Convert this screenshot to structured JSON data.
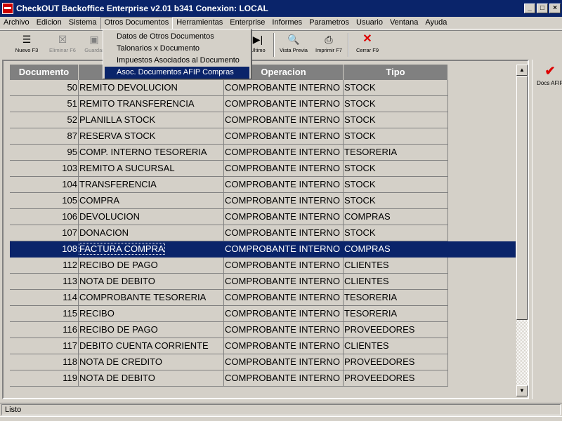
{
  "window": {
    "title": "CheckOUT Backoffice Enterprise v2.01 b341 Conexion: LOCAL",
    "min_label": "_",
    "max_label": "□",
    "close_label": "×"
  },
  "menu": {
    "items": [
      "Archivo",
      "Edicion",
      "Sistema",
      "Otros Documentos",
      "Herramientas",
      "Enterprise",
      "Informes",
      "Parametros",
      "Usuario",
      "Ventana",
      "Ayuda"
    ],
    "open_index": 3
  },
  "dropdown": {
    "items": [
      "Datos de Otros Documentos",
      "Talonarios x Documento",
      "Impuestos Asociados al Documento",
      "Asoc. Documentos AFIP Compras"
    ],
    "highlighted_index": 3
  },
  "toolbar": {
    "nuevo": "Nuevo F3",
    "eliminar": "Eliminar F6",
    "guardar": "Guardar",
    "ultimo": "Ultimo",
    "vista_previa": "Vista Previa",
    "imprimir": "Imprimir F7",
    "cerrar": "Cerrar F9"
  },
  "grid": {
    "columns": [
      "Documento",
      "",
      "Operacion",
      "Tipo"
    ],
    "selected_index": 10,
    "rows": [
      {
        "id": "50",
        "desc": "REMITO DEVOLUCION",
        "op": "COMPROBANTE INTERNO",
        "tipo": "STOCK"
      },
      {
        "id": "51",
        "desc": "REMITO TRANSFERENCIA",
        "op": "COMPROBANTE INTERNO",
        "tipo": "STOCK"
      },
      {
        "id": "52",
        "desc": "PLANILLA STOCK",
        "op": "COMPROBANTE INTERNO",
        "tipo": "STOCK"
      },
      {
        "id": "87",
        "desc": "RESERVA STOCK",
        "op": "COMPROBANTE INTERNO",
        "tipo": "STOCK"
      },
      {
        "id": "95",
        "desc": "COMP. INTERNO TESORERIA",
        "op": "COMPROBANTE INTERNO",
        "tipo": "TESORERIA"
      },
      {
        "id": "103",
        "desc": "REMITO A SUCURSAL",
        "op": "COMPROBANTE INTERNO",
        "tipo": "STOCK"
      },
      {
        "id": "104",
        "desc": "TRANSFERENCIA",
        "op": "COMPROBANTE INTERNO",
        "tipo": "STOCK"
      },
      {
        "id": "105",
        "desc": "COMPRA",
        "op": "COMPROBANTE INTERNO",
        "tipo": "STOCK"
      },
      {
        "id": "106",
        "desc": "DEVOLUCION",
        "op": "COMPROBANTE INTERNO",
        "tipo": "COMPRAS"
      },
      {
        "id": "107",
        "desc": "DONACION",
        "op": "COMPROBANTE INTERNO",
        "tipo": "STOCK"
      },
      {
        "id": "108",
        "desc": "FACTURA COMPRA",
        "op": "COMPROBANTE INTERNO",
        "tipo": "COMPRAS"
      },
      {
        "id": "112",
        "desc": "RECIBO DE PAGO",
        "op": "COMPROBANTE INTERNO",
        "tipo": "CLIENTES"
      },
      {
        "id": "113",
        "desc": "NOTA DE DEBITO",
        "op": "COMPROBANTE INTERNO",
        "tipo": "CLIENTES"
      },
      {
        "id": "114",
        "desc": "COMPROBANTE TESORERIA",
        "op": "COMPROBANTE INTERNO",
        "tipo": "TESORERIA"
      },
      {
        "id": "115",
        "desc": "RECIBO",
        "op": "COMPROBANTE INTERNO",
        "tipo": "TESORERIA"
      },
      {
        "id": "116",
        "desc": "RECIBO DE PAGO",
        "op": "COMPROBANTE INTERNO",
        "tipo": "PROVEEDORES"
      },
      {
        "id": "117",
        "desc": "DEBITO CUENTA CORRIENTE",
        "op": "COMPROBANTE INTERNO",
        "tipo": "CLIENTES"
      },
      {
        "id": "118",
        "desc": "NOTA DE CREDITO",
        "op": "COMPROBANTE INTERNO",
        "tipo": "PROVEEDORES"
      },
      {
        "id": "119",
        "desc": "NOTA DE DEBITO",
        "op": "COMPROBANTE INTERNO",
        "tipo": "PROVEEDORES"
      }
    ]
  },
  "scrollbar": {
    "up": "▲",
    "down": "▼"
  },
  "right_panel": {
    "docs_afip": "Docs AFIP"
  },
  "status": {
    "text": "Listo"
  },
  "colors": {
    "titlebar": "#0a246a",
    "selection": "#0a246a",
    "header": "#808080",
    "face": "#d4d0c8"
  }
}
